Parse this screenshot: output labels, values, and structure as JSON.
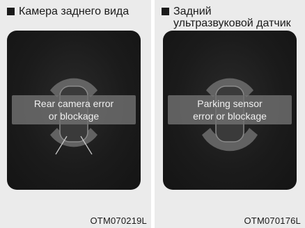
{
  "left_panel": {
    "caption": "Камера заднего вида",
    "message_line1": "Rear camera error",
    "message_line2": "or blockage",
    "code": "OTM070219L"
  },
  "right_panel": {
    "caption": "Задний ультразвуковой датчик",
    "message_line1": "Parking sensor",
    "message_line2": "error or blockage",
    "code": "OTM070176L"
  }
}
